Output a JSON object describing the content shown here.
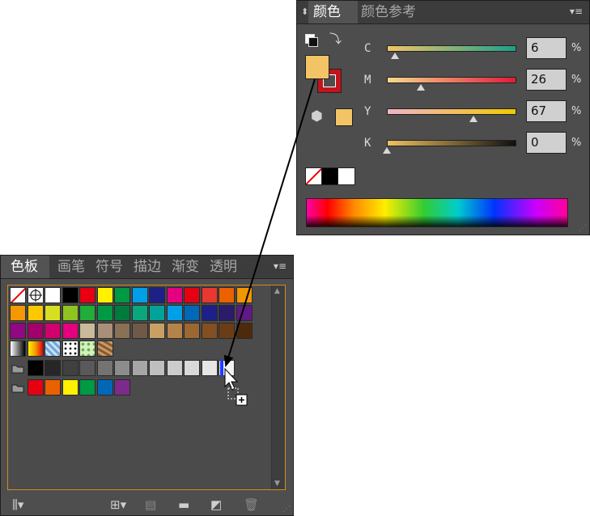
{
  "color_panel": {
    "tabs": [
      "颜色",
      "颜色参考"
    ],
    "fill_color": "#f2c466",
    "stroke_color": "#c2141c",
    "channels": [
      {
        "label": "C",
        "value": "6",
        "pct": 0.06,
        "gradient": [
          "#f2c466",
          "#1aa08a"
        ]
      },
      {
        "label": "M",
        "value": "26",
        "pct": 0.26,
        "gradient": [
          "#f6da8a",
          "#e01b3c"
        ]
      },
      {
        "label": "Y",
        "value": "67",
        "pct": 0.67,
        "gradient": [
          "#f0b4c8",
          "#f2c800"
        ]
      },
      {
        "label": "K",
        "value": "0",
        "pct": 0.0,
        "gradient": [
          "#f0c060",
          "#101010"
        ]
      }
    ],
    "percent_sign": "%"
  },
  "swatches_panel": {
    "tabs": [
      "色板",
      "画笔",
      "符号",
      "描边",
      "渐变",
      "透明"
    ],
    "rows": [
      [
        "none",
        "registration",
        "#ffffff",
        "#000000",
        "#e60012",
        "#fff100",
        "#009944",
        "#00a0e9",
        "#1d2088",
        "#e4007f",
        "#e50012",
        "#e8382f",
        "#eb6100",
        "#f29600"
      ],
      [
        "#f39800",
        "#fcc800",
        "#d8df20",
        "#8fc31f",
        "#22ac38",
        "#009944",
        "#007b3e",
        "#0aa77d",
        "#00a29a",
        "#00a0e9",
        "#0068b7",
        "#1d2088",
        "#2a1b6b",
        "#601986"
      ],
      [
        "#920783",
        "#a4006c",
        "#d2006e",
        "#e4007f",
        "#c9ba9a",
        "#a89078",
        "#8a7055",
        "#705a47",
        "#c9a063",
        "#b4834a",
        "#9c6731",
        "#834f22",
        "#6a3d16",
        "#4e2a0d"
      ],
      [
        "grad-bw",
        "grad-orange",
        "pattern-blue",
        "pattern-dots",
        "pattern-leaves",
        "pattern-wood"
      ],
      [
        "folder",
        "#000000",
        "#262626",
        "#404040",
        "#595959",
        "#737373",
        "#8c8c8c",
        "#a6a6a6",
        "#bfbfbf",
        "#cccccc",
        "#d9d9d9",
        "#e6e6e6",
        "#f2f2f2"
      ],
      [
        "folder",
        "#e60012",
        "#eb6100",
        "#fff100",
        "#009944",
        "#0068b7",
        "#7d2a8c"
      ]
    ]
  }
}
